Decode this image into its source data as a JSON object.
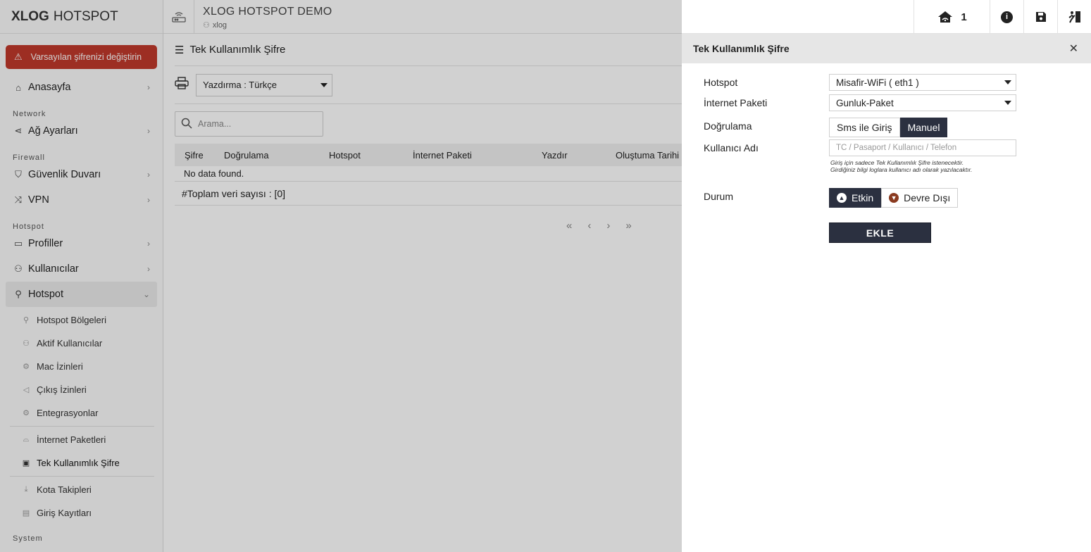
{
  "brand": {
    "bold": "XLOG",
    "rest": "HOTSPOT"
  },
  "alert": {
    "text": "Varsayılan şifrenizi değiştirin"
  },
  "sidebar": {
    "items": [
      {
        "label": "Anasayfa",
        "icon": "home-icon"
      },
      {
        "section": "Network"
      },
      {
        "label": "Ağ Ayarları",
        "icon": "share-icon"
      },
      {
        "section": "Firewall"
      },
      {
        "label": "Güvenlik Duvarı",
        "icon": "shield-icon"
      },
      {
        "label": "VPN",
        "icon": "shuffle-icon"
      },
      {
        "section": "Hotspot"
      },
      {
        "label": "Profiller",
        "icon": "layers-icon"
      },
      {
        "label": "Kullanıcılar",
        "icon": "users-icon"
      },
      {
        "label": "Hotspot",
        "icon": "user-check-icon"
      }
    ],
    "sections": {
      "network": "Network",
      "firewall": "Firewall",
      "hotspot": "Hotspot",
      "system": "System"
    },
    "nav": {
      "anasayfa": "Anasayfa",
      "ag": "Ağ Ayarları",
      "guvenlik": "Güvenlik Duvarı",
      "vpn": "VPN",
      "profiller": "Profiller",
      "kullanicilar": "Kullanıcılar",
      "hotspot": "Hotspot"
    },
    "sub": {
      "bolgeler": "Hotspot Bölgeleri",
      "aktif": "Aktif Kullanıcılar",
      "mac": "Mac İzinleri",
      "cikis": "Çıkış İzinleri",
      "entegrasyon": "Entegrasyonlar",
      "paketler": "İnternet Paketleri",
      "tek": "Tek Kullanımlık Şifre",
      "kota": "Kota Takipleri",
      "giris": "Giriş Kayıtları"
    }
  },
  "topbar": {
    "title": "XLOG HOTSPOT DEMO",
    "user": "xlog",
    "counter": "1"
  },
  "main": {
    "page_title": "Tek Kullanımlık Şifre",
    "print_select": "Yazdırma : Türkçe",
    "search_placeholder": "Arama...",
    "columns": [
      "Şifre",
      "Doğrulama",
      "Hotspot",
      "İnternet Paketi",
      "Yazdır",
      "Oluştuma Tarihi"
    ],
    "no_data": "No data found.",
    "total": "#Toplam veri sayısı : [0]"
  },
  "drawer": {
    "title": "Tek Kullanımlık Şifre",
    "labels": {
      "hotspot": "Hotspot",
      "paket": "İnternet Paketi",
      "dogrulama": "Doğrulama",
      "kullanici": "Kullanıcı Adı",
      "durum": "Durum"
    },
    "hotspot_value": "Misafir-WiFi ( eth1 )",
    "paket_value": "Gunluk-Paket",
    "dogrulama_options": {
      "sms": "Sms ile Giriş",
      "manuel": "Manuel"
    },
    "dogrulama_selected": "Manuel",
    "kullanici_placeholder": "TC / Pasaport / Kullanıcı / Telefon",
    "hint_line1": "Giriş için sadece Tek Kullanımlık Şifre istenecektir.",
    "hint_line2": "Girdiğiniz bilgi loglara kullanıcı adı olarak yazılacaktır.",
    "durum_options": {
      "etkin": "Etkin",
      "devre": "Devre Dışı"
    },
    "durum_selected": "Etkin",
    "submit": "EKLE"
  },
  "colors": {
    "accent": "#2b3040",
    "alert": "#c0392b"
  }
}
